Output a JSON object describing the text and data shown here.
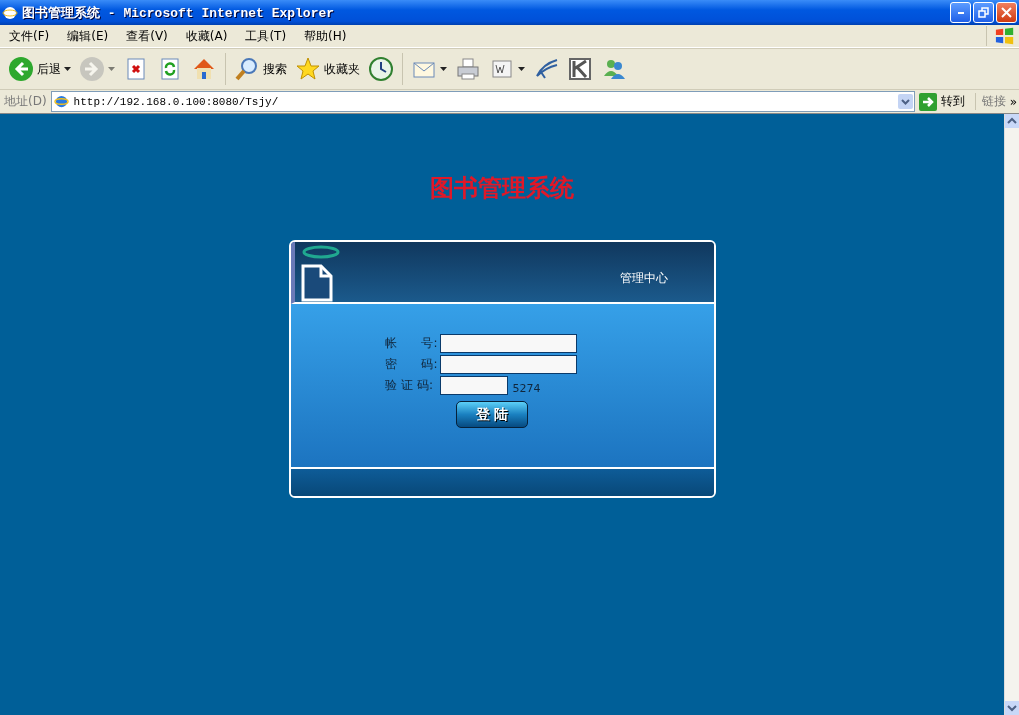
{
  "window": {
    "title": "图书管理系统 - Microsoft Internet Explorer"
  },
  "menu": [
    "文件(F)",
    "编辑(E)",
    "查看(V)",
    "收藏(A)",
    "工具(T)",
    "帮助(H)"
  ],
  "toolbar": [
    {
      "kind": "back",
      "label": "后退",
      "dropdown": true,
      "disabled": false
    },
    {
      "kind": "forward",
      "dropdown": true,
      "disabled": true
    },
    {
      "kind": "stop",
      "disabled": false
    },
    {
      "kind": "refresh",
      "disabled": false
    },
    {
      "kind": "home",
      "disabled": false
    },
    {
      "kind": "search",
      "label": "搜索",
      "disabled": false
    },
    {
      "kind": "favorites",
      "label": "收藏夹",
      "disabled": false
    },
    {
      "kind": "history",
      "disabled": false
    },
    {
      "kind": "mail",
      "dropdown": true,
      "disabled": false
    },
    {
      "kind": "print",
      "disabled": false
    },
    {
      "kind": "word",
      "dropdown": true,
      "disabled": false
    },
    {
      "kind": "quill",
      "disabled": false
    },
    {
      "kind": "kbox",
      "disabled": false
    },
    {
      "kind": "messenger",
      "disabled": false
    }
  ],
  "address_bar": {
    "label": "地址(D)",
    "url": "http://192.168.0.100:8080/Tsjy/",
    "go_label": "转到",
    "links_label": "链接",
    "more": "»"
  },
  "page": {
    "heading": "图书管理系统",
    "panel_title": "管理中心",
    "fields": [
      {
        "label": "帐　　号:",
        "kind": "text"
      },
      {
        "label": "密　　码:",
        "kind": "password"
      },
      {
        "label": "验 证 码:",
        "kind": "captcha",
        "captcha": "5274"
      }
    ],
    "login_button": "登 陆"
  }
}
